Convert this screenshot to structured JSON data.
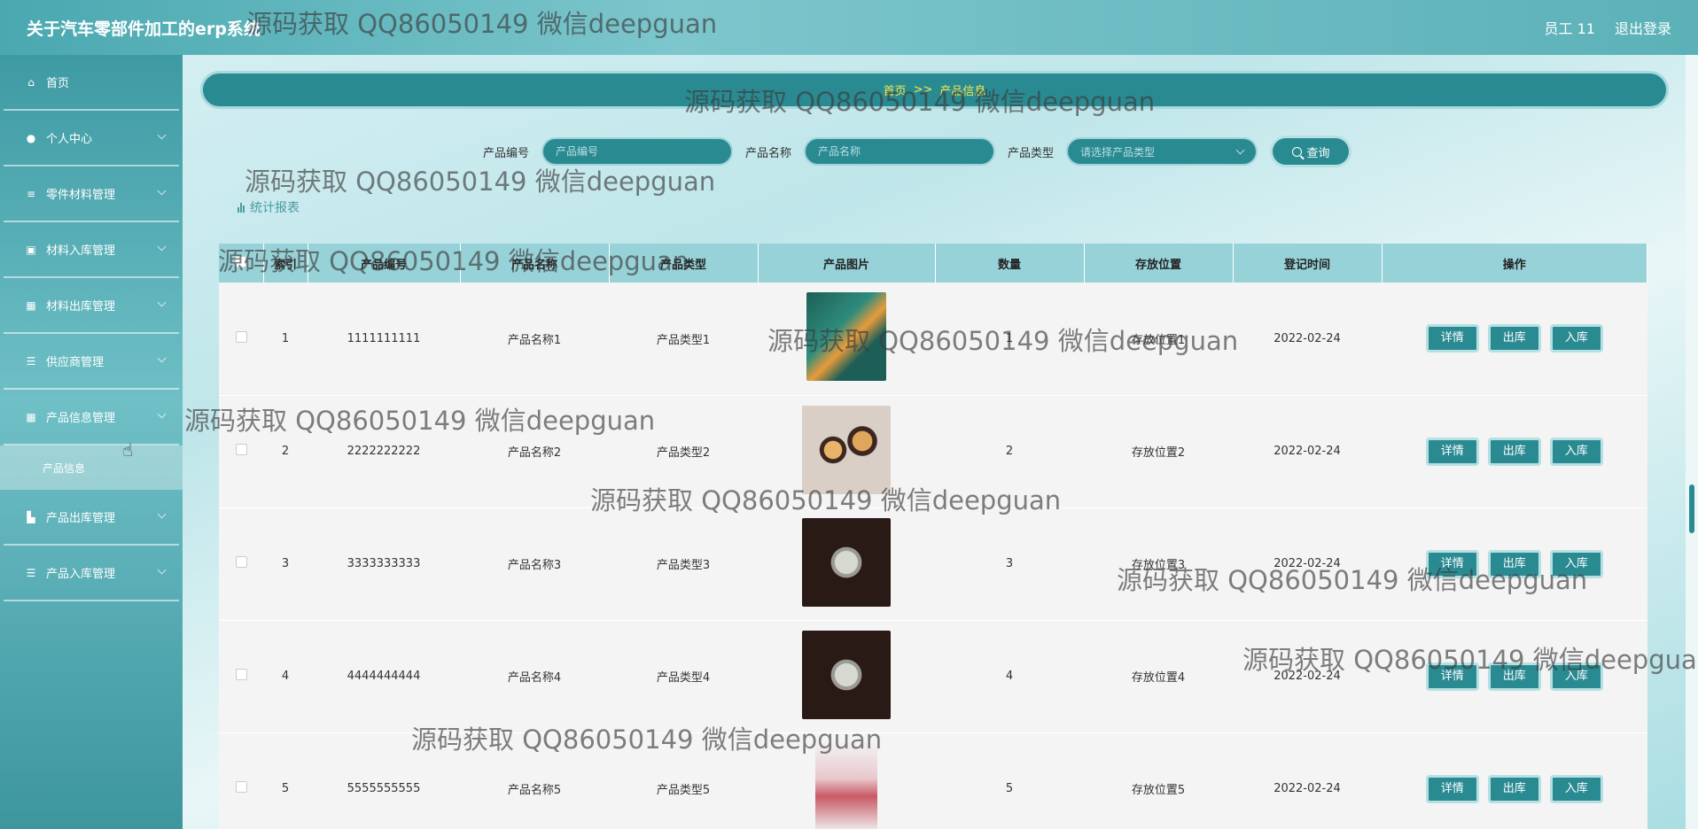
{
  "header": {
    "app_title": "关于汽车零部件加工的erp系统",
    "user_label": "员工 11",
    "logout_label": "退出登录"
  },
  "sidebar": {
    "items": [
      {
        "label": "首页",
        "icon": "home-icon"
      },
      {
        "label": "个人中心",
        "icon": "user-icon"
      },
      {
        "label": "零件材料管理",
        "icon": "sliders-icon"
      },
      {
        "label": "材料入库管理",
        "icon": "chart-icon"
      },
      {
        "label": "材料出库管理",
        "icon": "grid-icon"
      },
      {
        "label": "供应商管理",
        "icon": "list-icon"
      },
      {
        "label": "产品信息管理",
        "icon": "grid-icon"
      },
      {
        "label": "产品出库管理",
        "icon": "truck-icon"
      },
      {
        "label": "产品入库管理",
        "icon": "list-icon"
      }
    ],
    "active_sub": "产品信息"
  },
  "breadcrumb": {
    "home": "首页",
    "separator": ">>",
    "current": "产品信息"
  },
  "search": {
    "code_label": "产品编号",
    "code_placeholder": "产品编号",
    "name_label": "产品名称",
    "name_placeholder": "产品名称",
    "type_label": "产品类型",
    "type_placeholder": "请选择产品类型",
    "query_label": "查询"
  },
  "report_label": "统计报表",
  "table": {
    "columns": [
      "",
      "索引",
      "产品编号",
      "产品名称",
      "产品类型",
      "产品图片",
      "数量",
      "存放位置",
      "登记时间",
      "操作"
    ],
    "rows": [
      {
        "index": "1",
        "code": "1111111111",
        "name": "产品名称1",
        "type": "产品类型1",
        "qty": "1",
        "location": "存放位置1",
        "date": "2022-02-24"
      },
      {
        "index": "2",
        "code": "2222222222",
        "name": "产品名称2",
        "type": "产品类型2",
        "qty": "2",
        "location": "存放位置2",
        "date": "2022-02-24"
      },
      {
        "index": "3",
        "code": "3333333333",
        "name": "产品名称3",
        "type": "产品类型3",
        "qty": "3",
        "location": "存放位置3",
        "date": "2022-02-24"
      },
      {
        "index": "4",
        "code": "4444444444",
        "name": "产品名称4",
        "type": "产品类型4",
        "qty": "4",
        "location": "存放位置4",
        "date": "2022-02-24"
      },
      {
        "index": "5",
        "code": "5555555555",
        "name": "产品名称5",
        "type": "产品类型5",
        "qty": "5",
        "location": "存放位置5",
        "date": "2022-02-24"
      }
    ],
    "actions": {
      "detail": "详情",
      "out": "出库",
      "in": "入库"
    }
  },
  "watermark": "源码获取 QQ86050149 微信deepguan",
  "colors": {
    "accent": "#2a8a92",
    "header": "#5cb1b8",
    "breadcrumb_text": "#f5e84a"
  }
}
